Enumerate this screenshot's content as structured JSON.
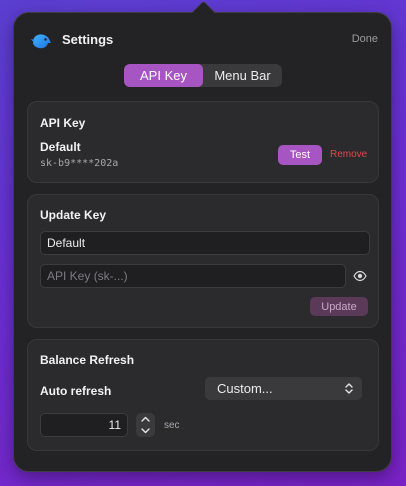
{
  "header": {
    "title": "Settings",
    "done_label": "Done"
  },
  "tabs": [
    {
      "label": "API Key",
      "active": true
    },
    {
      "label": "Menu Bar",
      "active": false
    }
  ],
  "api_key_card": {
    "title": "API Key",
    "key_name": "Default",
    "key_masked": "sk-b9****202a",
    "test_label": "Test",
    "remove_label": "Remove"
  },
  "update_key_card": {
    "title": "Update Key",
    "name_value": "Default",
    "api_key_value": "",
    "api_key_placeholder": "API Key (sk-...)",
    "update_label": "Update"
  },
  "balance_card": {
    "title": "Balance Refresh",
    "auto_refresh_label": "Auto refresh",
    "auto_refresh_selected": "Custom...",
    "interval_value": "11",
    "unit_label": "sec"
  },
  "icons": {
    "app_logo": "bird-logo-icon",
    "eye": "eye-icon",
    "select_chevrons": "chevron-up-down-icon",
    "stepper_up": "chevron-up-icon",
    "stepper_down": "chevron-down-icon"
  },
  "colors": {
    "accent": "#a855c4",
    "danger": "#e0474b",
    "panel_bg": "#232325",
    "card_bg": "#2b2b2e",
    "update_disabled_bg": "#5a3a58"
  }
}
